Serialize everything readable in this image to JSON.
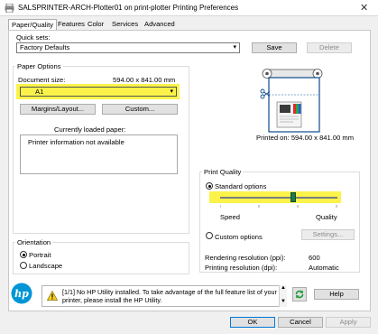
{
  "window": {
    "title": "SALSPRINTER-ARCH-Plotter01 on print-plotter Printing Preferences",
    "close_glyph": "✕"
  },
  "tabs": [
    {
      "label": "Paper/Quality",
      "active": true
    },
    {
      "label": "Features"
    },
    {
      "label": "Color"
    },
    {
      "label": "Services"
    },
    {
      "label": "Advanced"
    }
  ],
  "quick_sets": {
    "label": "Quick sets:",
    "value": "Factory Defaults",
    "save_label": "Save",
    "delete_label": "Delete"
  },
  "paper_options": {
    "group_label": "Paper Options",
    "document_size_label": "Document size:",
    "document_size_dims": "594.00 x 841.00 mm",
    "document_size_value": "A1",
    "margins_label": "Margins/Layout...",
    "custom_label": "Custom...",
    "loaded_paper_label": "Currently loaded paper:",
    "loaded_paper_text": "Printer information not available"
  },
  "preview": {
    "printed_on": "Printed on: 594.00 x 841.00 mm"
  },
  "print_quality": {
    "group_label": "Print Quality",
    "standard_label": "Standard options",
    "speed_label": "Speed",
    "quality_label": "Quality",
    "slider_level_fraction": 0.62,
    "custom_label": "Custom options",
    "settings_label": "Settings...",
    "rendering_label": "Rendering resolution (ppi):",
    "rendering_value": "600",
    "printing_label": "Printing resolution (dpi):",
    "printing_value": "Automatic"
  },
  "orientation": {
    "group_label": "Orientation",
    "portrait_label": "Portrait",
    "landscape_label": "Landscape"
  },
  "footer": {
    "logo_text": "hp",
    "message": "[1/1] No HP Utility installed. To take advantage of the full feature list of your printer, please install the HP Utility.",
    "help_label": "Help",
    "ok_label": "OK",
    "cancel_label": "Cancel",
    "apply_label": "Apply"
  },
  "colors": {
    "highlight": "#fbf23a",
    "slider_thumb": "#1f7a4a",
    "hp_blue": "#0096d6",
    "accent": "#0078d7"
  }
}
